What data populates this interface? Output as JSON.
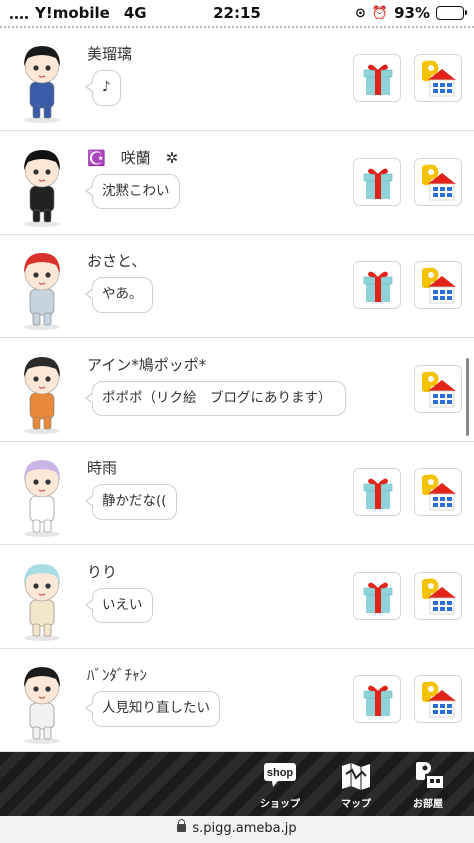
{
  "status_bar": {
    "carrier": "Y!mobile",
    "network": "4G",
    "time": "22:15",
    "battery_percent": "93%",
    "battery_level": 0.93
  },
  "friends": [
    {
      "name": "美瑠璃",
      "message": "♪",
      "has_gift": true,
      "avatar_colors": [
        "#1a1a1a",
        "#3a5ba8"
      ]
    },
    {
      "name": "☪️　咲蘭　✲",
      "message": "沈黙こわい",
      "has_gift": true,
      "avatar_colors": [
        "#111111",
        "#222222"
      ]
    },
    {
      "name": "おさと、",
      "message": "やあ。",
      "has_gift": true,
      "avatar_colors": [
        "#d9302b",
        "#c8d3e0"
      ]
    },
    {
      "name": "アイン*鳩ポッポ*",
      "message": "ポポポ（リク絵　ブログにあります）",
      "has_gift": false,
      "avatar_colors": [
        "#2a2a2a",
        "#e8893a"
      ]
    },
    {
      "name": "時雨",
      "message": "静かだな((",
      "has_gift": true,
      "avatar_colors": [
        "#c9b6e6",
        "#ffffff"
      ]
    },
    {
      "name": "りり",
      "message": "いえい",
      "has_gift": true,
      "avatar_colors": [
        "#a8dde6",
        "#f4e6c8"
      ]
    },
    {
      "name": "ﾊﾞﾝﾀﾞﾁｬﾝ",
      "message": "人見知り直したい",
      "has_gift": true,
      "avatar_colors": [
        "#1c1c1c",
        "#f1f1f1"
      ]
    }
  ],
  "bottom_nav": {
    "shop_badge": "shop",
    "shop_label": "ショップ",
    "map_label": "マップ",
    "room_label": "お部屋"
  },
  "url": "s.pigg.ameba.jp",
  "icons": {
    "gift": "gift-icon",
    "home": "home-p-icon"
  },
  "colors": {
    "gift_red": "#e2231a",
    "gift_box": "#8fd3d8",
    "home_yellow": "#f5c200",
    "home_red": "#e2231a",
    "home_blue": "#2a6fd6",
    "bottom_bar": "#1f1f1f"
  }
}
